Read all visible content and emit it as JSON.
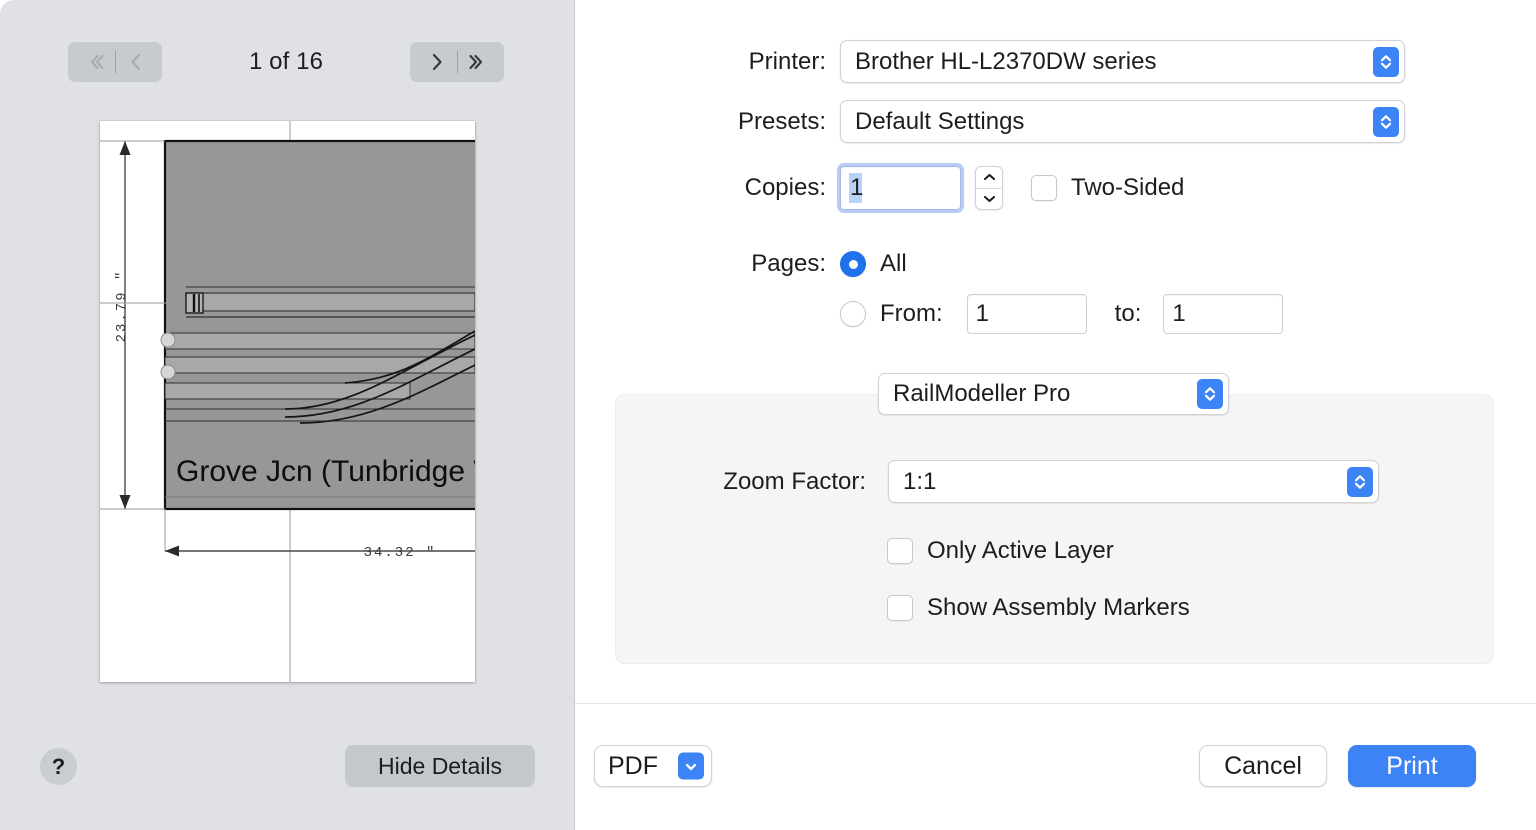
{
  "preview": {
    "page_counter": "1 of 16",
    "nav": {
      "first_page": "first-page",
      "previous_page": "previous-page",
      "next_page": "next-page",
      "last_page": "last-page"
    },
    "drawing": {
      "title_label": "Grove Jcn (Tunbridge W",
      "vertical_dimension": "23.79 \"",
      "horizontal_dimension": "34.32 \"",
      "marker_label": "I"
    },
    "help_label": "?",
    "hide_details_label": "Hide Details"
  },
  "options": {
    "printer": {
      "label": "Printer:",
      "value": "Brother HL-L2370DW series"
    },
    "presets": {
      "label": "Presets:",
      "value": "Default Settings"
    },
    "copies": {
      "label": "Copies:",
      "value": "1",
      "two_sided_label": "Two-Sided",
      "two_sided_checked": false
    },
    "pages": {
      "label": "Pages:",
      "all_label": "All",
      "all_selected": true,
      "from_label": "From:",
      "from_value": "1",
      "to_label": "to:",
      "to_value": "1",
      "range_selected": false
    },
    "plugin": {
      "value": "RailModeller Pro",
      "zoom_factor_label": "Zoom Factor:",
      "zoom_factor_value": "1:1",
      "only_active_layer_label": "Only Active Layer",
      "only_active_layer_checked": false,
      "show_assembly_markers_label": "Show Assembly Markers",
      "show_assembly_markers_checked": false
    }
  },
  "actions": {
    "pdf_label": "PDF",
    "cancel_label": "Cancel",
    "print_label": "Print"
  },
  "colors": {
    "accent_blue": "#3c83f6",
    "radio_blue": "#1f72ec",
    "sidebar_bg": "#dfe1e4",
    "panel_bg": "#ffffff",
    "group_bg": "#f5f5f5",
    "selection_blue": "#b9d3f7"
  }
}
